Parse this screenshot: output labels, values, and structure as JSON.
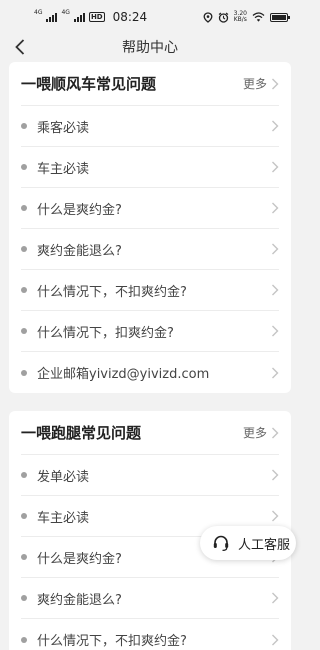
{
  "status_bar": {
    "network_1": "4G",
    "network_2": "4G",
    "hd": "HD",
    "time": "08:24",
    "speed_value": "3.20",
    "speed_unit": "KB/s",
    "battery_label": "100",
    "battery_level": 1.0
  },
  "header": {
    "title": "帮助中心",
    "icon": "chevron-left-icon"
  },
  "sections": [
    {
      "title": "一喂顺风车常见问题",
      "more": "更多",
      "items": [
        "乘客必读",
        "车主必读",
        "什么是爽约金?",
        "爽约金能退么?",
        "什么情况下，不扣爽约金?",
        "什么情况下，扣爽约金?",
        "企业邮箱yivizd@yivizd.com"
      ]
    },
    {
      "title": "一喂跑腿常见问题",
      "more": "更多",
      "items": [
        "发单必读",
        "车主必读",
        "什么是爽约金?",
        "爽约金能退么?",
        "什么情况下，不扣爽约金?"
      ]
    }
  ],
  "support_button": {
    "label": "人工客服",
    "icon": "headset-icon"
  },
  "colors": {
    "background": "#f2f2f2",
    "card": "#ffffff",
    "dot": "#a0a0a0",
    "chevron": "#c4c4c4"
  }
}
